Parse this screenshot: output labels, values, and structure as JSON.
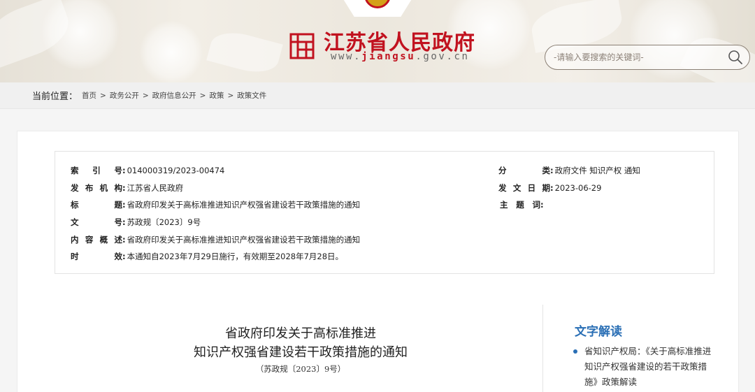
{
  "header": {
    "site_title": "江苏省人民政府",
    "url_prefix": "www.",
    "url_domain": "jiangsu",
    "url_suffix": ".gov.cn",
    "search_placeholder": "-请输入要搜索的关键词-",
    "search_icon": "search-icon",
    "colors": {
      "brand": "#c1121f",
      "accent": "#2a6fb5"
    }
  },
  "breadcrumb": {
    "label": "当前位置：",
    "items": [
      "首页",
      "政务公开",
      "政府信息公开",
      "政策",
      "政策文件"
    ],
    "separator": ">"
  },
  "meta": {
    "left": [
      {
        "key": "索引号",
        "value": "014000319/2023-00474"
      },
      {
        "key": "发布机构",
        "value": "江苏省人民政府"
      },
      {
        "key": "标题",
        "value": "省政府印发关于高标准推进知识产权强省建设若干政策措施的通知"
      },
      {
        "key": "文号",
        "value": "苏政规〔2023〕9号"
      },
      {
        "key": "内容概述",
        "value": "省政府印发关于高标准推进知识产权强省建设若干政策措施的通知"
      },
      {
        "key": "时效",
        "value": "本通知自2023年7月29日施行，有效期至2028年7月28日。"
      }
    ],
    "right": [
      {
        "key": "分类",
        "value": "政府文件 知识产权 通知"
      },
      {
        "key": "发文日期",
        "value": "2023-06-29"
      },
      {
        "key": "主题词",
        "value": ""
      }
    ]
  },
  "document": {
    "title_line1": "省政府印发关于高标准推进",
    "title_line2": "知识产权强省建设若干政策措施的通知",
    "number": "（苏政规〔2023〕9号）"
  },
  "sidebar": {
    "title": "文字解读",
    "items": [
      {
        "label": "省知识产权局：《关于高标准推进知识产权强省建设的若干政策措施》政策解读"
      }
    ]
  }
}
